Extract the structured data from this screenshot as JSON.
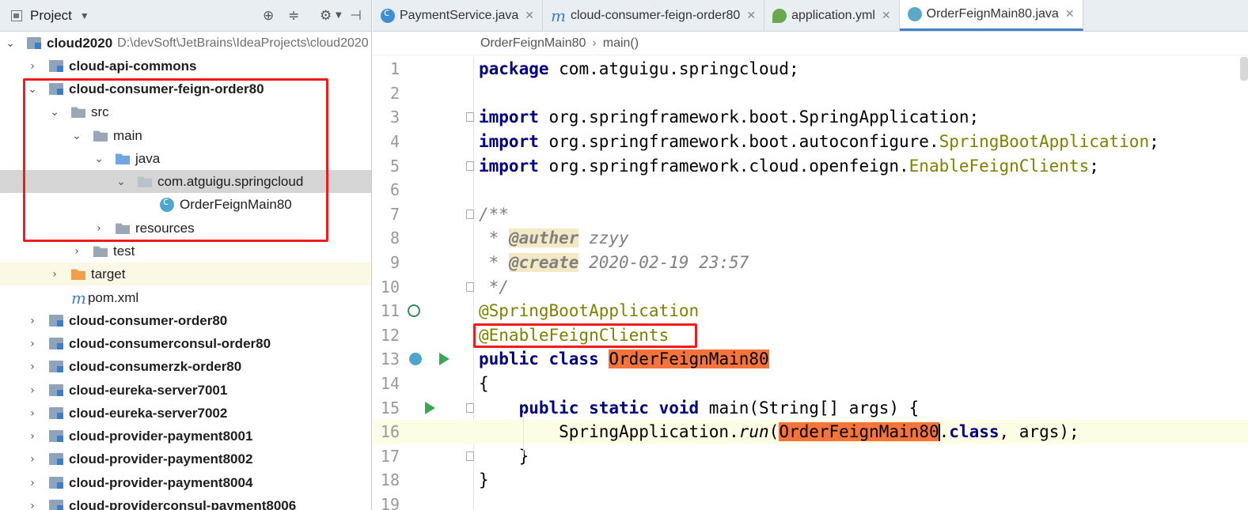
{
  "project_panel": {
    "title": "Project",
    "tree": [
      {
        "label": "cloud2020",
        "path": "D:\\devSoft\\JetBrains\\IdeaProjects\\cloud2020",
        "icon": "module-icon",
        "expanded": true,
        "bold": true
      },
      {
        "label": "cloud-api-commons",
        "icon": "module-icon",
        "expanded": false,
        "bold": true
      },
      {
        "label": "cloud-consumer-feign-order80",
        "icon": "module-icon",
        "expanded": true,
        "bold": true
      },
      {
        "label": "src",
        "icon": "folder-icon",
        "expanded": true
      },
      {
        "label": "main",
        "icon": "folder-icon",
        "expanded": true
      },
      {
        "label": "java",
        "icon": "source-folder-icon",
        "expanded": true
      },
      {
        "label": "com.atguigu.springcloud",
        "icon": "package-icon",
        "expanded": true,
        "selected": true
      },
      {
        "label": "OrderFeignMain80",
        "icon": "spring-class-icon"
      },
      {
        "label": "resources",
        "icon": "resources-folder-icon",
        "expanded": false
      },
      {
        "label": "test",
        "icon": "folder-icon",
        "expanded": false
      },
      {
        "label": "target",
        "icon": "excluded-folder-icon",
        "expanded": false
      },
      {
        "label": "pom.xml",
        "icon": "maven-icon"
      },
      {
        "label": "cloud-consumer-order80",
        "icon": "module-icon",
        "expanded": false,
        "bold": true
      },
      {
        "label": "cloud-consumerconsul-order80",
        "icon": "module-icon",
        "expanded": false,
        "bold": true
      },
      {
        "label": "cloud-consumerzk-order80",
        "icon": "module-icon",
        "expanded": false,
        "bold": true
      },
      {
        "label": "cloud-eureka-server7001",
        "icon": "module-icon",
        "expanded": false,
        "bold": true
      },
      {
        "label": "cloud-eureka-server7002",
        "icon": "module-icon",
        "expanded": false,
        "bold": true
      },
      {
        "label": "cloud-provider-payment8001",
        "icon": "module-icon",
        "expanded": false,
        "bold": true
      },
      {
        "label": "cloud-provider-payment8002",
        "icon": "module-icon",
        "expanded": false,
        "bold": true
      },
      {
        "label": "cloud-provider-payment8004",
        "icon": "module-icon",
        "expanded": false,
        "bold": true
      },
      {
        "label": "cloud-providerconsul-payment8006",
        "icon": "module-icon",
        "expanded": false,
        "bold": true
      }
    ]
  },
  "tabs": [
    {
      "label": "PaymentService.java",
      "icon": "class-icon"
    },
    {
      "label": "cloud-consumer-feign-order80",
      "icon": "maven-icon"
    },
    {
      "label": "application.yml",
      "icon": "yaml-icon"
    },
    {
      "label": "OrderFeignMain80.java",
      "icon": "spring-class-icon",
      "active": true
    }
  ],
  "breadcrumb": [
    "OrderFeignMain80",
    "main()"
  ],
  "code": {
    "current_line": 16,
    "lines": [
      "1",
      "2",
      "3",
      "4",
      "5",
      "6",
      "7",
      "8",
      "9",
      "10",
      "11",
      "12",
      "13",
      "14",
      "15",
      "16",
      "17",
      "18",
      "19"
    ],
    "l1_kw": "package",
    "l1_rest": " com.atguigu.springcloud;",
    "l3_kw": "import",
    "l3_rest": " org.springframework.boot.SpringApplication;",
    "l4_kw": "import",
    "l4_rest": " org.springframework.boot.autoconfigure.",
    "l4_ann": "SpringBootApplication",
    "l4_end": ";",
    "l5_kw": "import",
    "l5_rest": " org.springframework.cloud.openfeign.",
    "l5_ann": "EnableFeignClients",
    "l5_end": ";",
    "l7": "/**",
    "l8_pre": " * ",
    "l8_tag": "@auther",
    "l8_val": " zzyy",
    "l9_pre": " * ",
    "l9_tag": "@create",
    "l9_val": " 2020-02-19 23:57",
    "l10": " */",
    "l11": "@SpringBootApplication",
    "l12": "@EnableFeignClients",
    "l13_kw": "public class ",
    "l13_cls": "OrderFeignMain80",
    "l14": "{",
    "l15_pre": "    ",
    "l15_kw": "public static void",
    "l15_rest": " main(String[] args) {",
    "l16_pre": "        SpringApplication.",
    "l16_fn": "run",
    "l16_paren": "(",
    "l16_cls": "OrderFeignMain80",
    "l16_dot": ".",
    "l16_kw": "class",
    "l16_rest": ", args);",
    "l17": "    }",
    "l18": "}"
  },
  "colors": {
    "highlight_box": "#ef1c1c",
    "class_highlight": "#f5743b",
    "keyword": "#000080",
    "annotation": "#808000",
    "comment": "#808080"
  }
}
